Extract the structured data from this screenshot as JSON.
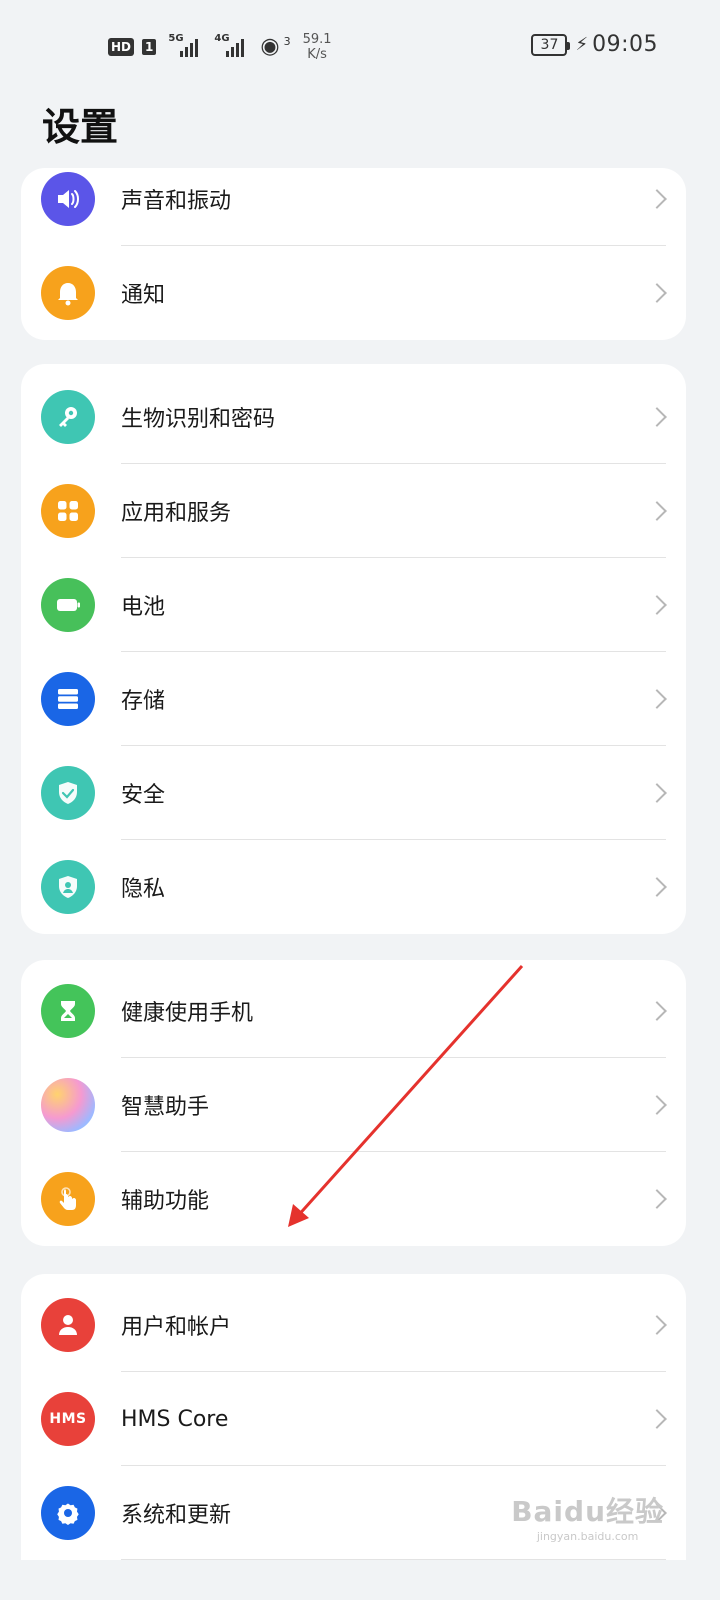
{
  "status_bar": {
    "hd": "HD",
    "sim": "1",
    "net1": "5G",
    "net2": "4G",
    "hotspot_count": "3",
    "speed_value": "59.1",
    "speed_unit": "K/s",
    "battery": "37",
    "time": "09:05"
  },
  "page": {
    "title": "设置"
  },
  "groups": [
    {
      "items": [
        {
          "label": "声音和振动",
          "icon": "volume-icon",
          "color": "#5b55e8"
        },
        {
          "label": "通知",
          "icon": "bell-icon",
          "color": "#f7a21c"
        }
      ]
    },
    {
      "items": [
        {
          "label": "生物识别和密码",
          "icon": "key-icon",
          "color": "#3fc6b3"
        },
        {
          "label": "应用和服务",
          "icon": "apps-icon",
          "color": "#f7a21c"
        },
        {
          "label": "电池",
          "icon": "battery-icon",
          "color": "#47c05a"
        },
        {
          "label": "存储",
          "icon": "storage-icon",
          "color": "#1a66e6"
        },
        {
          "label": "安全",
          "icon": "shield-check-icon",
          "color": "#3fc6b3"
        },
        {
          "label": "隐私",
          "icon": "privacy-shield-icon",
          "color": "#3fc6b3"
        }
      ]
    },
    {
      "items": [
        {
          "label": "健康使用手机",
          "icon": "hourglass-icon",
          "color": "#44c45a"
        },
        {
          "label": "智慧助手",
          "icon": "assistant-icon",
          "color": "#e89ad6"
        },
        {
          "label": "辅助功能",
          "icon": "hand-pointer-icon",
          "color": "#f7a21c"
        }
      ]
    },
    {
      "items": [
        {
          "label": "用户和帐户",
          "icon": "user-icon",
          "color": "#e8413a"
        },
        {
          "label": "HMS Core",
          "icon": "hms-icon",
          "color": "#e8413a"
        },
        {
          "label": "系统和更新",
          "icon": "gear-icon",
          "color": "#1a66e6"
        }
      ]
    }
  ],
  "hms_badge": "HMS",
  "watermark": {
    "main": "Baidu经验",
    "sub": "jingyan.baidu.com"
  }
}
